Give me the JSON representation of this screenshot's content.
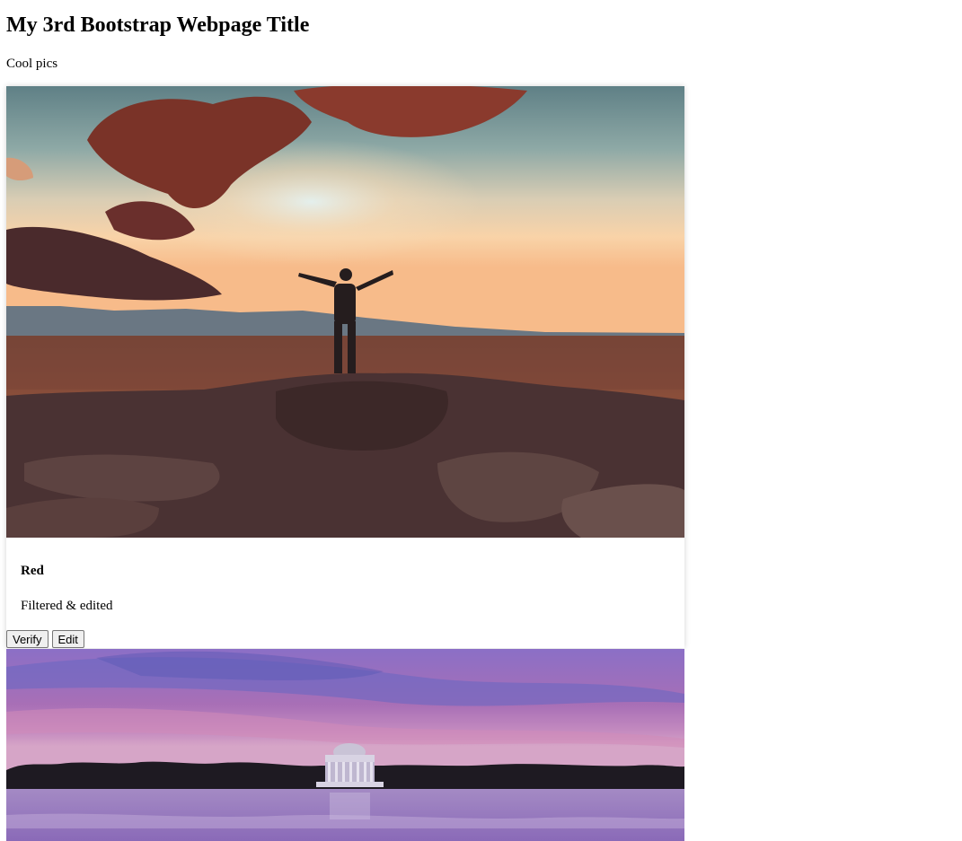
{
  "page": {
    "title": "My 3rd Bootstrap Webpage Title",
    "subtitle": "Cool pics"
  },
  "cards": [
    {
      "image": "sunset-desert-person-photo",
      "title": "Red",
      "text": "Filtered & edited",
      "buttons": [
        "Verify",
        "Edit"
      ]
    },
    {
      "image": "purple-sky-memorial-lake-photo"
    }
  ],
  "colors": {
    "background": "#ffffff",
    "button_bg": "#efefef",
    "button_border": "#767676"
  }
}
